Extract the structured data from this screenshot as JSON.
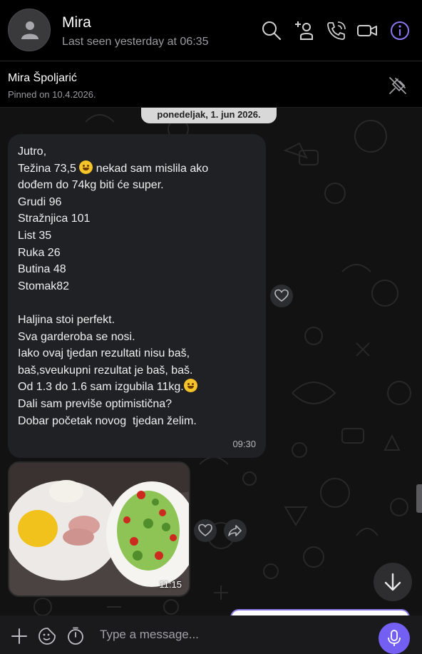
{
  "header": {
    "contact_name": "Mira",
    "last_seen": "Last seen yesterday at 06:35",
    "icons": [
      "search-icon",
      "add-participant-icon",
      "call-icon",
      "video-call-icon",
      "info-icon"
    ]
  },
  "pinned": {
    "name": "Mira Špoljarić",
    "date": "Pinned on 10.4.2026.",
    "icon": "unpin-icon"
  },
  "chat": {
    "date_separator": "ponedeljak, 1. jun 2026.",
    "messages": [
      {
        "type": "text",
        "lines": [
          "Jutro,",
          "Težina 73,5 ",
          "dođem do 74kg biti će super.",
          "Grudi 96",
          "Stražnjica 101",
          "List 35",
          "Ruka 26",
          "Butina 48",
          "Stomak82",
          "",
          "Haljina stoi perfekt.",
          "Sva garderoba se nosi.",
          "Iako ovaj tjedan rezultati nisu baš,",
          "baš,sveukupni rezultat je baš, baš.",
          "Od 1.3 do 1.6 sam izgubila 11kg.",
          "Dali sam previše optimistična?",
          "Dobar početak novog  tjedan želim."
        ],
        "line2_suffix": " nekad sam mislila ako",
        "time": "09:30"
      },
      {
        "type": "photo",
        "description_icon": "food-photo",
        "time": "11:15"
      }
    ]
  },
  "input": {
    "placeholder": "Type a message...",
    "icons": [
      "plus-icon",
      "sticker-icon",
      "timer-icon",
      "mic-icon"
    ]
  },
  "colors": {
    "accent": "#7360f2",
    "bubble": "#1f2124",
    "background": "#000000",
    "date_pill": "#d8d8d8"
  }
}
